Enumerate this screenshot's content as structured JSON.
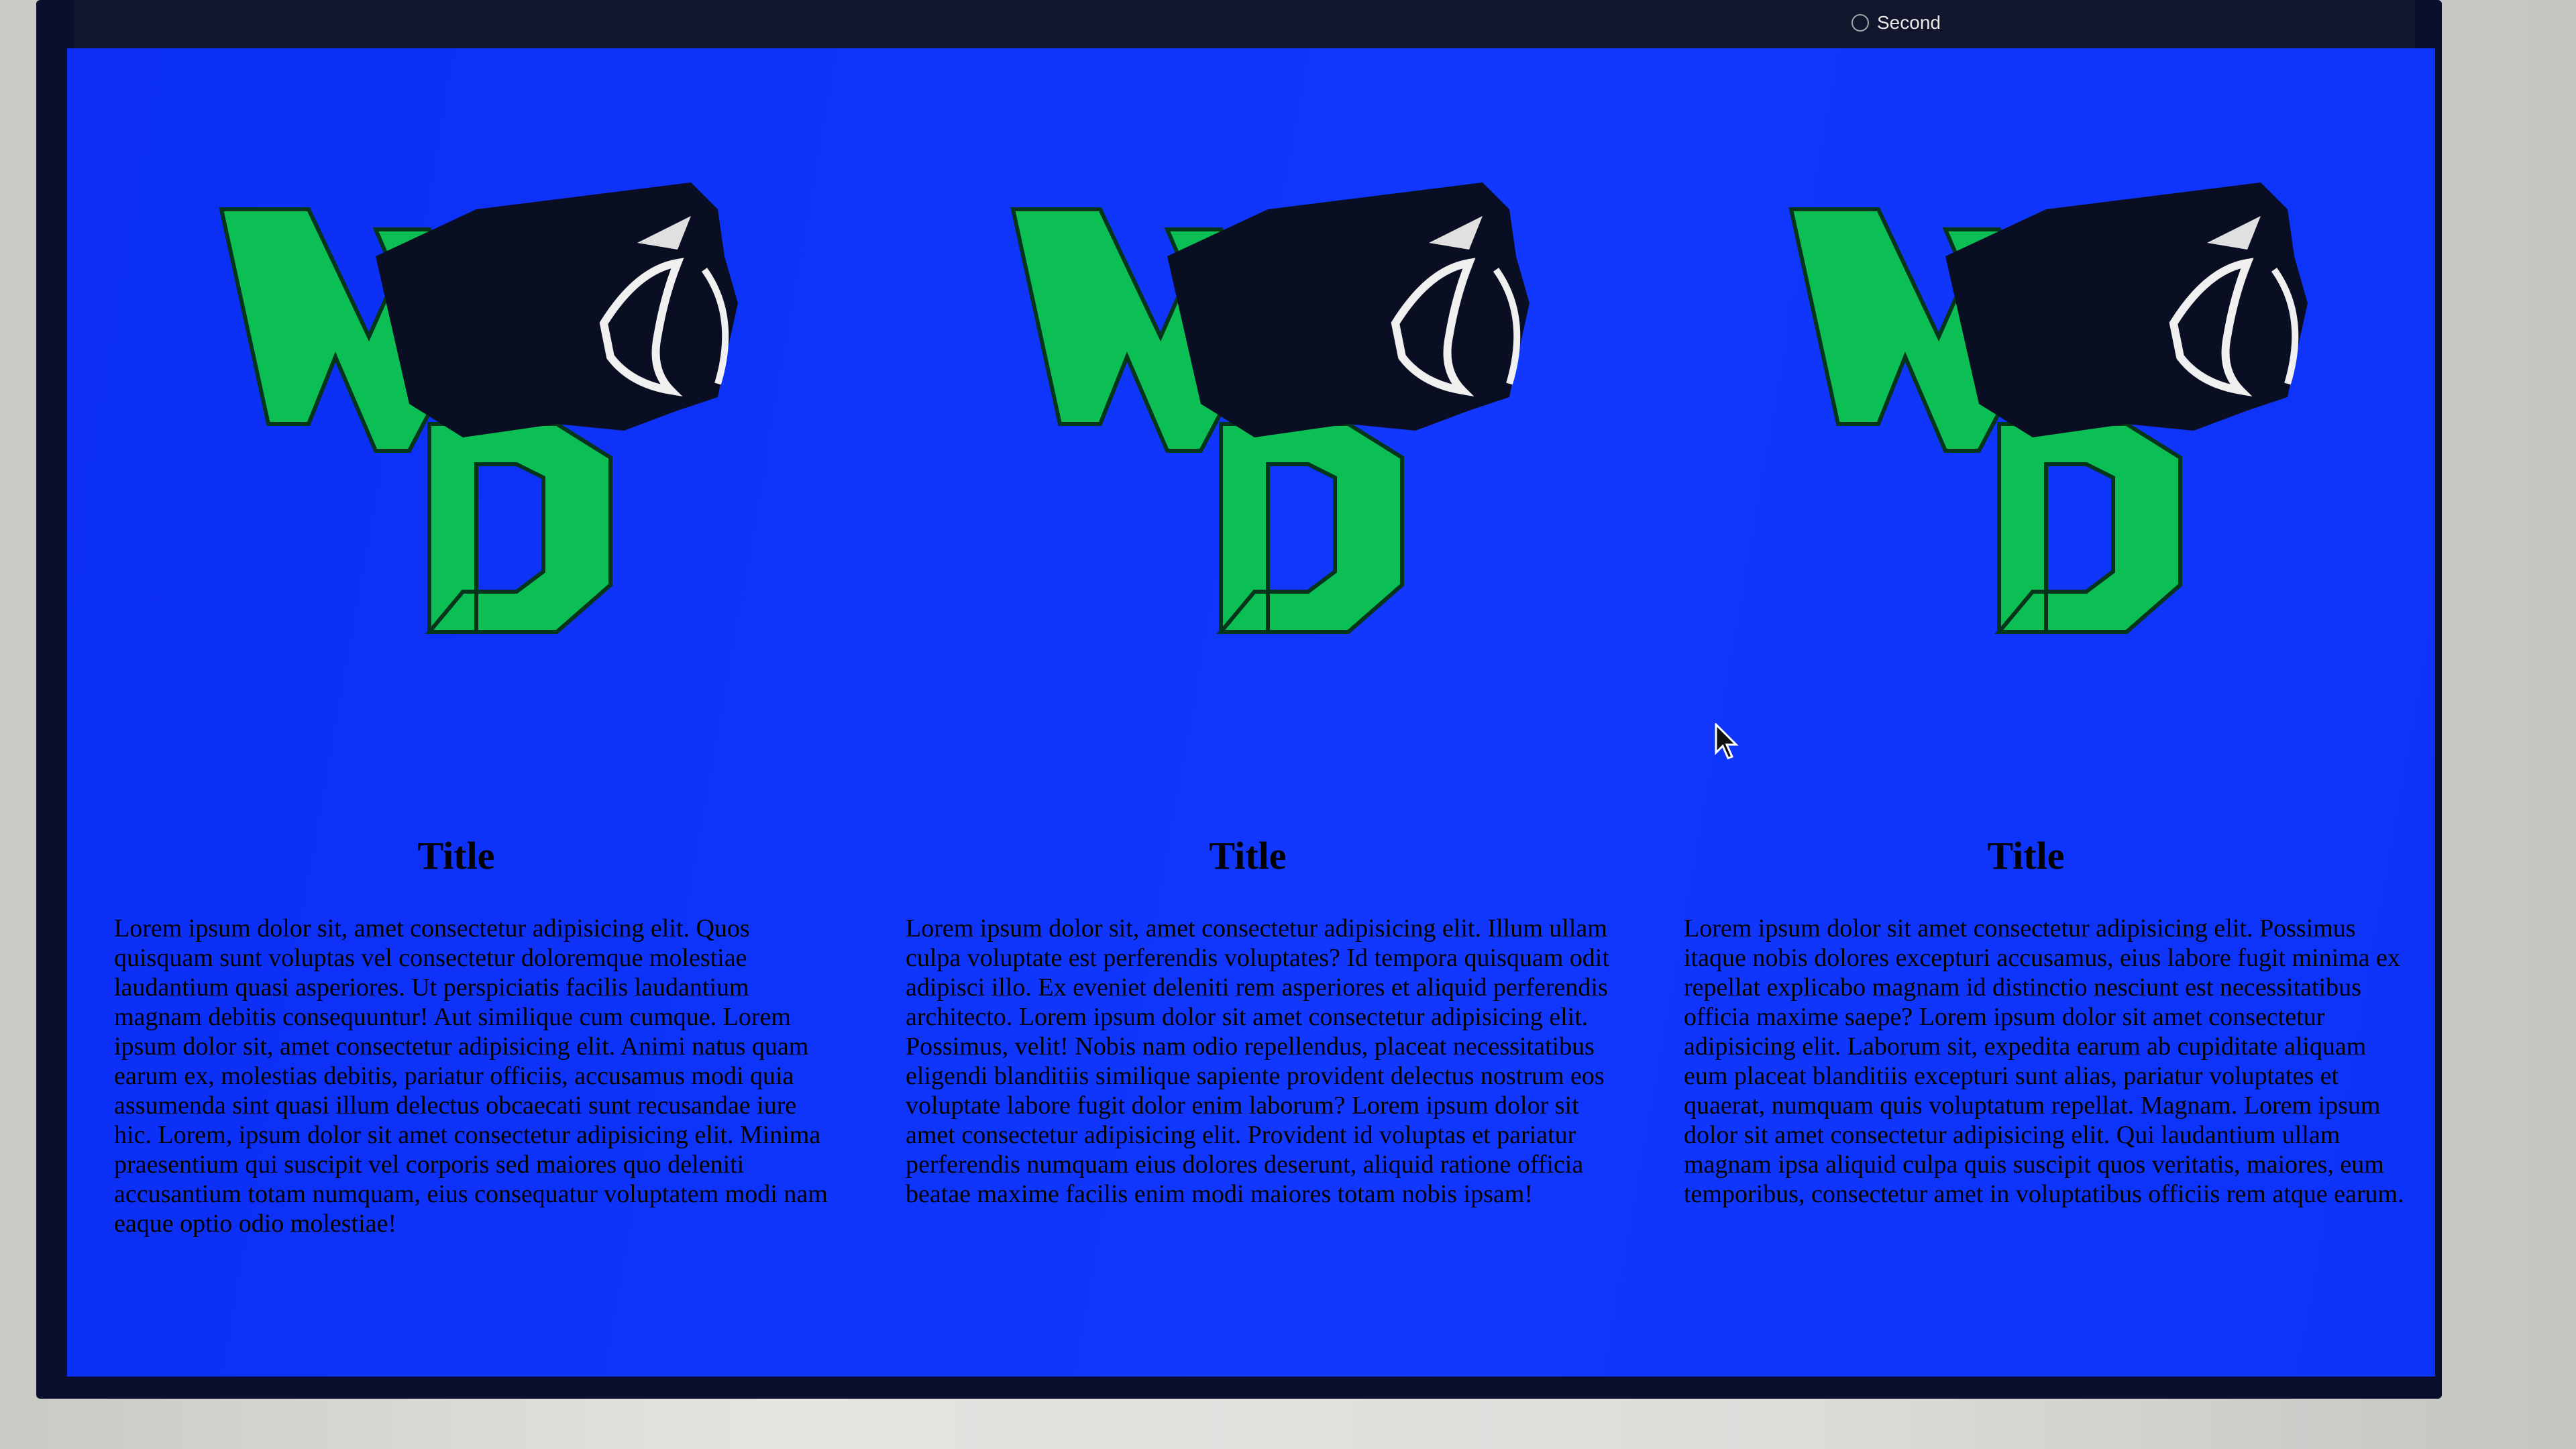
{
  "menubar": {
    "item_label": "Second"
  },
  "columns": [
    {
      "title": "Title",
      "text": "Lorem ipsum dolor sit, amet consectetur adipisicing elit. Quos quisquam sunt voluptas vel consectetur doloremque molestiae laudantium quasi asperiores. Ut perspiciatis facilis laudantium magnam debitis consequuntur! Aut similique cum cumque. Lorem ipsum dolor sit, amet consectetur adipisicing elit. Animi natus quam earum ex, molestias debitis, pariatur officiis, accusamus modi quia assumenda sint quasi illum delectus obcaecati sunt recusandae iure hic. Lorem, ipsum dolor sit amet consectetur adipisicing elit. Minima praesentium qui suscipit vel corporis sed maiores quo deleniti accusantium totam numquam, eius consequatur voluptatem modi nam eaque optio odio molestiae!",
      "logo": "WD panther logo"
    },
    {
      "title": "Title",
      "text": "Lorem ipsum dolor sit, amet consectetur adipisicing elit. Illum ullam culpa voluptate est perferendis voluptates? Id tempora quisquam odit adipisci illo. Ex eveniet deleniti rem asperiores et aliquid perferendis architecto. Lorem ipsum dolor sit amet consectetur adipisicing elit. Possimus, velit! Nobis nam odio repellendus, placeat necessitatibus eligendi blanditiis similique sapiente provident delectus nostrum eos voluptate labore fugit dolor enim laborum? Lorem ipsum dolor sit amet consectetur adipisicing elit. Provident id voluptas et pariatur perferendis numquam eius dolores deserunt, aliquid ratione officia beatae maxime facilis enim modi maiores totam nobis ipsam!",
      "logo": "WD panther logo"
    },
    {
      "title": "Title",
      "text": "Lorem ipsum dolor sit amet consectetur adipisicing elit. Possimus itaque nobis dolores excepturi accusamus, eius labore fugit minima ex repellat explicabo magnam id distinctio nesciunt est necessitatibus officia maxime saepe? Lorem ipsum dolor sit amet consectetur adipisicing elit. Laborum sit, expedita earum ab cupiditate aliquam eum placeat blanditiis excepturi sunt alias, pariatur voluptates et quaerat, numquam quis voluptatum repellat. Magnam. Lorem ipsum dolor sit amet consectetur adipisicing elit. Qui laudantium ullam magnam ipsa aliquid culpa quis suscipit quos veritatis, maiores, eum temporibus, consectetur amet in voluptatibus officiis rem atque earum.",
      "logo": "WD panther logo"
    }
  ],
  "colors": {
    "page_background": "#0f35fa",
    "logo_green": "#0cbf54",
    "logo_dark": "#0a0e22",
    "menubar": "#12162c"
  },
  "icons": {
    "menubar_check": "circle-check-icon",
    "cursor": "mouse-pointer-icon"
  }
}
